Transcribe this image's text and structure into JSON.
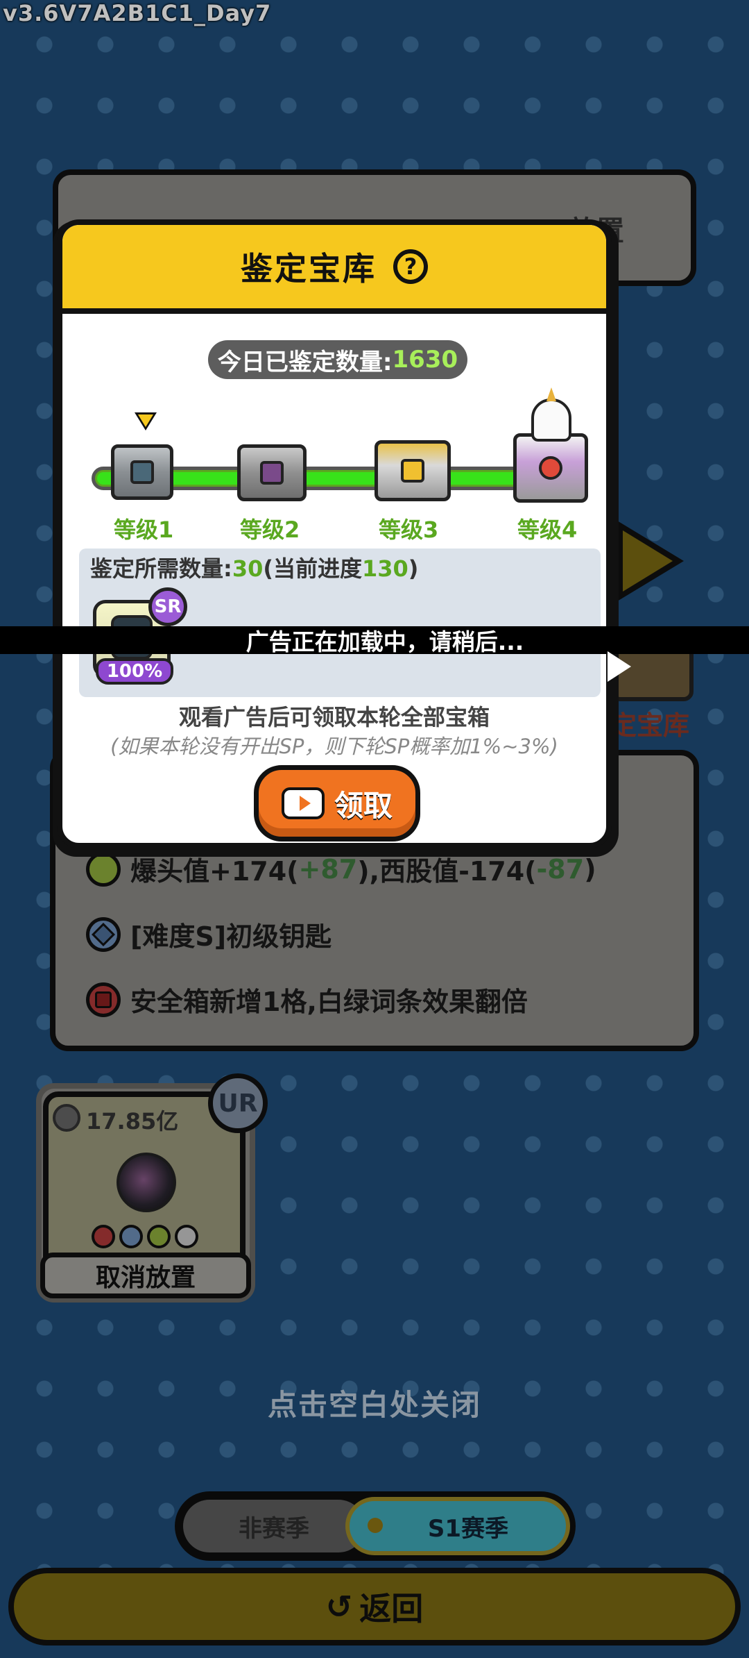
{
  "version": "v3.6V7A2B1C1_Day7",
  "background": {
    "top_card_right_text": "放置",
    "vault_label": "定宝库",
    "bonus_rows": [
      {
        "icon": "green-triangle-icon",
        "text": "爆头值+174(",
        "delta1": "+87",
        "mid": "),西股值-174(",
        "delta2": "-87",
        "end": ")"
      },
      {
        "icon": "blue-diamond-icon",
        "text": "[难度S]初级钥匙"
      },
      {
        "icon": "red-pentagon-icon",
        "text": "安全箱新增1格,白绿词条效果翻倍"
      }
    ]
  },
  "placed_card": {
    "rarity": "UR",
    "value": "17.85亿",
    "cancel_label": "取消放置"
  },
  "close_hint": "点击空白处关闭",
  "season": {
    "off_label": "非赛季",
    "on_label": "S1赛季"
  },
  "back_label": "返回",
  "modal": {
    "title": "鉴定宝库",
    "help": "?",
    "count_label": "今日已鉴定数量:",
    "count_value": "1630",
    "levels": [
      "等级1",
      "等级2",
      "等级3",
      "等级4"
    ],
    "requirement_prefix": "鉴定所需数量:",
    "requirement_value": "30",
    "progress_prefix": "(当前进度",
    "progress_value": "130",
    "progress_suffix": ")",
    "reward_rarity": "SR",
    "reward_percent": "100%",
    "ad_note": "观看广告后可领取本轮全部宝箱",
    "ad_sub": "(如果本轮没有开出SP，则下轮SP概率加1%~3%)",
    "claim_label": "领取"
  },
  "toast": "广告正在加载中，请稍后..."
}
